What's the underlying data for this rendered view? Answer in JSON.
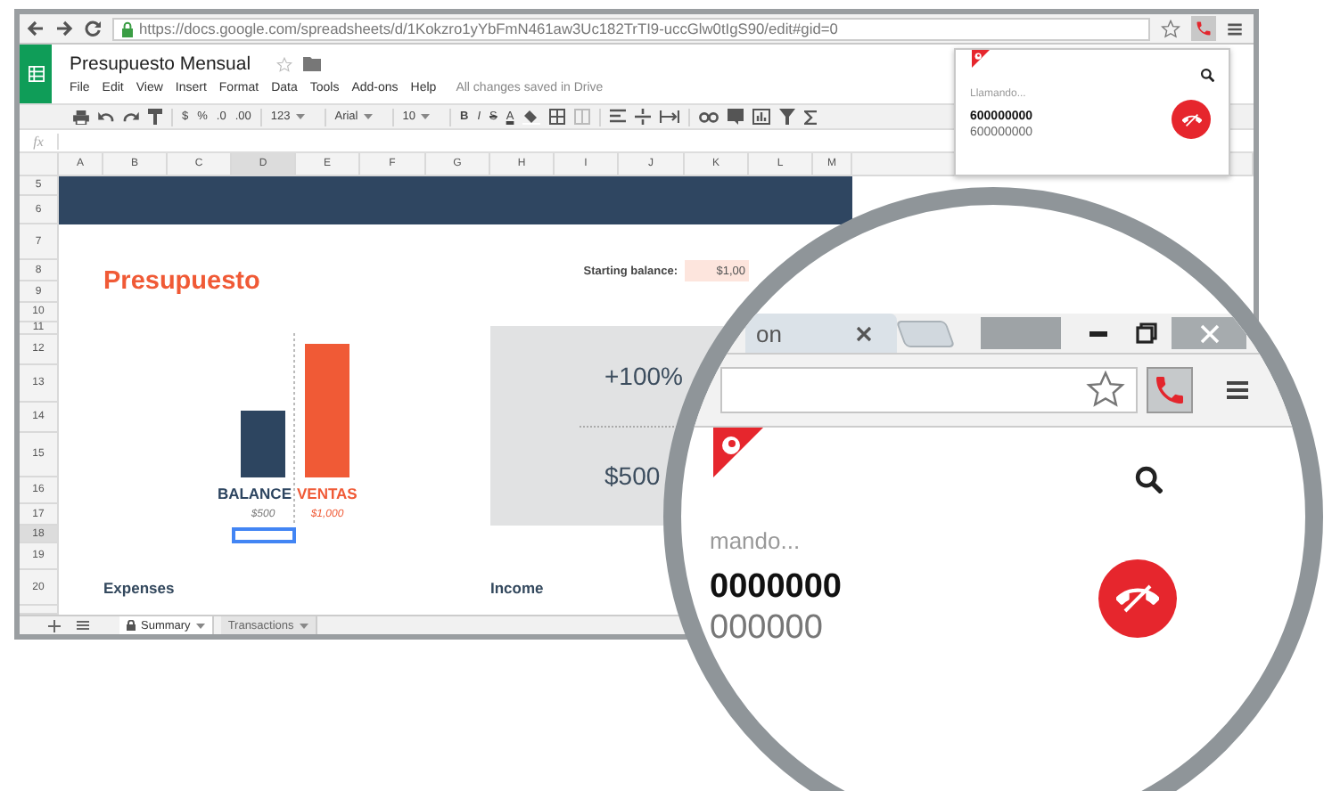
{
  "browser": {
    "url": "https://docs.google.com/spreadsheets/d/1Kokzro1yYbFmN461aw3Uc182TrTI9-uccGlw0tIgS90/edit#gid=0"
  },
  "sheet": {
    "title": "Presupuesto Mensual",
    "menus": [
      "File",
      "Edit",
      "View",
      "Insert",
      "Format",
      "Data",
      "Tools",
      "Add-ons",
      "Help"
    ],
    "save_status": "All changes saved in Drive",
    "toolbar": [
      {
        "kind": "button",
        "label": "$"
      },
      {
        "kind": "button",
        "label": "%"
      },
      {
        "kind": "button",
        "label": ".0"
      },
      {
        "kind": "button",
        "label": ".00"
      },
      {
        "kind": "dropdown",
        "label": "123"
      },
      {
        "kind": "dropdown",
        "label": "Arial"
      },
      {
        "kind": "dropdown",
        "label": "10"
      },
      {
        "kind": "bold",
        "label": "B"
      },
      {
        "kind": "italic",
        "label": "I"
      },
      {
        "kind": "strike",
        "label": "S"
      },
      {
        "kind": "color",
        "label": "A"
      }
    ],
    "formula_label": "fx",
    "columns": [
      {
        "label": "A",
        "selected": false
      },
      {
        "label": "B",
        "selected": false
      },
      {
        "label": "C",
        "selected": false
      },
      {
        "label": "D",
        "selected": true
      },
      {
        "label": "E",
        "selected": false
      },
      {
        "label": "F",
        "selected": false
      },
      {
        "label": "G",
        "selected": false
      },
      {
        "label": "H",
        "selected": false
      },
      {
        "label": "I",
        "selected": false
      },
      {
        "label": "J",
        "selected": false
      },
      {
        "label": "K",
        "selected": false
      },
      {
        "label": "L",
        "selected": false
      },
      {
        "label": "M",
        "selected": false
      }
    ],
    "rows": [
      {
        "label": "5",
        "selected": false
      },
      {
        "label": "6",
        "selected": false
      },
      {
        "label": "7",
        "selected": false
      },
      {
        "label": "8",
        "selected": false
      },
      {
        "label": "9",
        "selected": false
      },
      {
        "label": "10",
        "selected": false
      },
      {
        "label": "11",
        "selected": false
      },
      {
        "label": "12",
        "selected": false
      },
      {
        "label": "13",
        "selected": false
      },
      {
        "label": "14",
        "selected": false
      },
      {
        "label": "15",
        "selected": false
      },
      {
        "label": "16",
        "selected": false
      },
      {
        "label": "17",
        "selected": false
      },
      {
        "label": "18",
        "selected": true
      },
      {
        "label": "19",
        "selected": false
      },
      {
        "label": "20",
        "selected": false
      }
    ],
    "heading": "Presupuesto",
    "starting_balance": {
      "label": "Starting balance:",
      "value": "$1,00"
    },
    "chart_data": {
      "type": "bar",
      "categories": [
        "BALANCE",
        "VENTAS"
      ],
      "values": [
        500,
        1000
      ],
      "data_labels": true,
      "value_labels": [
        "$500",
        "$1,000"
      ]
    },
    "stats": [
      "+100%",
      "$500"
    ],
    "sections": [
      "Expenses",
      "Income"
    ],
    "sheet_tabs": [
      {
        "label": "Summary",
        "selected": true
      },
      {
        "label": "Transactions",
        "selected": false
      }
    ]
  },
  "call_popup": {
    "status": "Llamando...",
    "number": "600000000",
    "subtitle": "600000000"
  },
  "magnifier": {
    "tab_label": "on",
    "status": "mando...",
    "number": "0000000",
    "subtitle": "000000"
  }
}
